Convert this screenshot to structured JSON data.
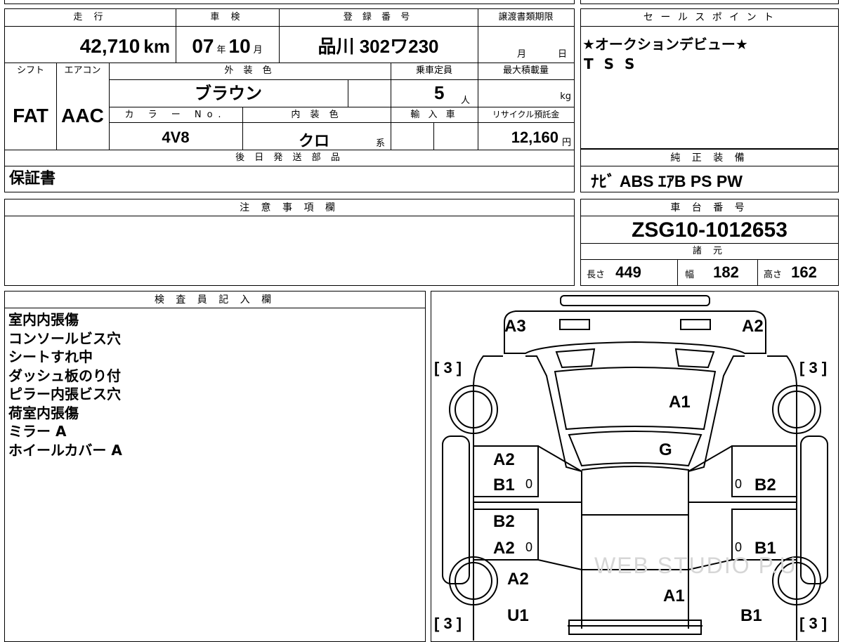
{
  "vehicle_info": {
    "mileage_header": "走 行",
    "mileage_value": "42,710",
    "mileage_unit": "km",
    "inspection_header": "車 検",
    "inspection_year": "07",
    "inspection_year_unit": "年",
    "inspection_month": "10",
    "inspection_month_unit": "月",
    "registration_header": "登 録 番 号",
    "registration_value": "品川 302ワ230",
    "transfer_doc_header": "譲渡書類期限",
    "transfer_month_unit": "月",
    "transfer_day_unit": "日",
    "shift_header": "シフト",
    "shift_value": "FAT",
    "ac_header": "エアコン",
    "ac_value": "AAC",
    "exterior_color_header": "外 装 色",
    "exterior_color_value": "ブラウン",
    "capacity_header": "乗車定員",
    "capacity_value": "5",
    "capacity_unit": "人",
    "max_load_header": "最大積載量",
    "max_load_unit": "kg",
    "color_no_header": "カ ラ ー No.",
    "color_no_value": "4V8",
    "interior_color_header": "内 装 色",
    "interior_color_value": "クロ",
    "interior_color_suffix": "系",
    "import_header": "輸 入 車",
    "recycle_header": "リサイクル預託金",
    "recycle_value": "12,160",
    "recycle_unit": "円",
    "later_parts_header": "後 日 発 送 部 品",
    "later_parts_value": "保証書"
  },
  "sales_point": {
    "header": "セ ー ル ス ポ イ ン ト",
    "lines": [
      "★オークションデビュー★",
      "T S S"
    ]
  },
  "equipment": {
    "header": "純 正 装 備",
    "value": "ﾅﾋﾞ ABS ｴｱB PS PW"
  },
  "notes": {
    "header": "注 意 事 項 欄"
  },
  "chassis": {
    "header": "車 台 番 号",
    "value": "ZSG10-1012653",
    "specs_header": "諸 元",
    "length_label": "長さ",
    "length_value": "449",
    "width_label": "幅",
    "width_value": "182",
    "height_label": "高さ",
    "height_value": "162"
  },
  "inspector": {
    "header": "検 査 員 記 入 欄",
    "lines": [
      "室内内張傷",
      "コンソールビス穴",
      "シートすれ中",
      "ダッシュ板のり付",
      "ピラー内張ビス穴",
      "荷室内張傷",
      "ミラー A",
      "ホイールカバー A"
    ]
  },
  "diagram": {
    "bracket_tl": "[ 3 ]",
    "bracket_tr": "[ 3 ]",
    "bracket_bl": "[ 3 ]",
    "bracket_br": "[ 3 ]",
    "mark_front_left": "A3",
    "mark_front_right": "A2",
    "mark_hood": "A1",
    "mark_windshield": "G",
    "mark_lf_door_top": "A2",
    "mark_lf_door_bottom": "B1",
    "mark_lr_door_top": "B2",
    "mark_lr_door_bottom": "A2",
    "mark_rf_door": "B2",
    "mark_rr_door": "B1",
    "zero_lf": "0",
    "zero_rf": "0",
    "zero_lr": "0",
    "zero_rr": "0",
    "mark_rear_left_a": "A2",
    "mark_rear_left_u": "U1",
    "mark_roof_rear": "A1",
    "mark_rear_right": "B1",
    "watermark": "WEB STUDIO P.U"
  }
}
